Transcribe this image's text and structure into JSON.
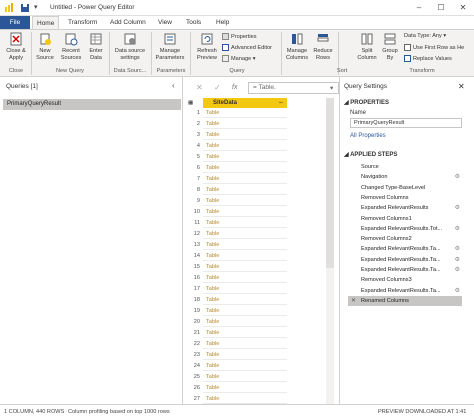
{
  "title_bar": {
    "title": "Untitled - Power Query Editor"
  },
  "tabs": [
    "File",
    "Home",
    "Transform",
    "Add Column",
    "View",
    "Tools",
    "Help"
  ],
  "ribbon": {
    "close_apply": "Close &\nApply",
    "new_source": "New\nSource",
    "recent_sources": "Recent\nSources",
    "enter_data": "Enter\nData",
    "data_source_settings": "Data source\nsettings",
    "manage_parameters": "Manage\nParameters",
    "refresh_preview": "Refresh\nPreview",
    "properties": "Properties",
    "advanced_editor": "Advanced Editor",
    "manage": "Manage",
    "manage_columns": "Manage\nColumns",
    "reduce_rows": "Reduce\nRows",
    "split_column": "Split\nColumn",
    "group_by": "Group\nBy",
    "data_type": "Data Type: Any",
    "use_first_row": "Use First Row as He",
    "replace_values": "Replace Values",
    "groups": {
      "close": "Close",
      "new_query": "New Query",
      "data_sources": "Data Sourc...",
      "parameters": "Parameters",
      "query": "Query",
      "sort": "Sort",
      "transform": "Transform"
    }
  },
  "queries_pane": {
    "header": "Queries [1]",
    "items": [
      "PrimaryQueryResult"
    ]
  },
  "formula_bar": {
    "fx": "fx",
    "formula": "= Table."
  },
  "grid": {
    "column_header": "SiteData",
    "cell_value": "Table",
    "row_numbers": [
      "1",
      "2",
      "3",
      "4",
      "5",
      "6",
      "7",
      "8",
      "9",
      "10",
      "11",
      "12",
      "13",
      "14",
      "15",
      "16",
      "17",
      "18",
      "19",
      "20",
      "21",
      "22",
      "23",
      "24",
      "25",
      "26",
      "27"
    ]
  },
  "query_settings": {
    "header": "Query Settings",
    "properties_label": "PROPERTIES",
    "name_label": "Name",
    "name_value": "PrimaryQueryResult",
    "all_properties": "All Properties",
    "applied_steps_label": "APPLIED STEPS",
    "steps": [
      "Source",
      "Navigation",
      "Changed Type-BaseLevel",
      "Removed Columns",
      "Expanded RelevantResults",
      "Removed Columns1",
      "Expanded RelevantResults.Tot...",
      "Removed Columns2",
      "Expanded RelevantResults.Ta...",
      "Expanded RelevantResults.Ta...",
      "Expanded RelevantResults.Ta...",
      "Removed Columns3",
      "Expanded RelevantResults.Ta...",
      "Renamed Columns"
    ]
  },
  "status_bar": {
    "columns_rows": "1 COLUMN, 440 ROWS",
    "profiling": "Column profiling based on top 1000 rows",
    "preview": "PREVIEW DOWNLOADED AT 1:41 PM"
  }
}
